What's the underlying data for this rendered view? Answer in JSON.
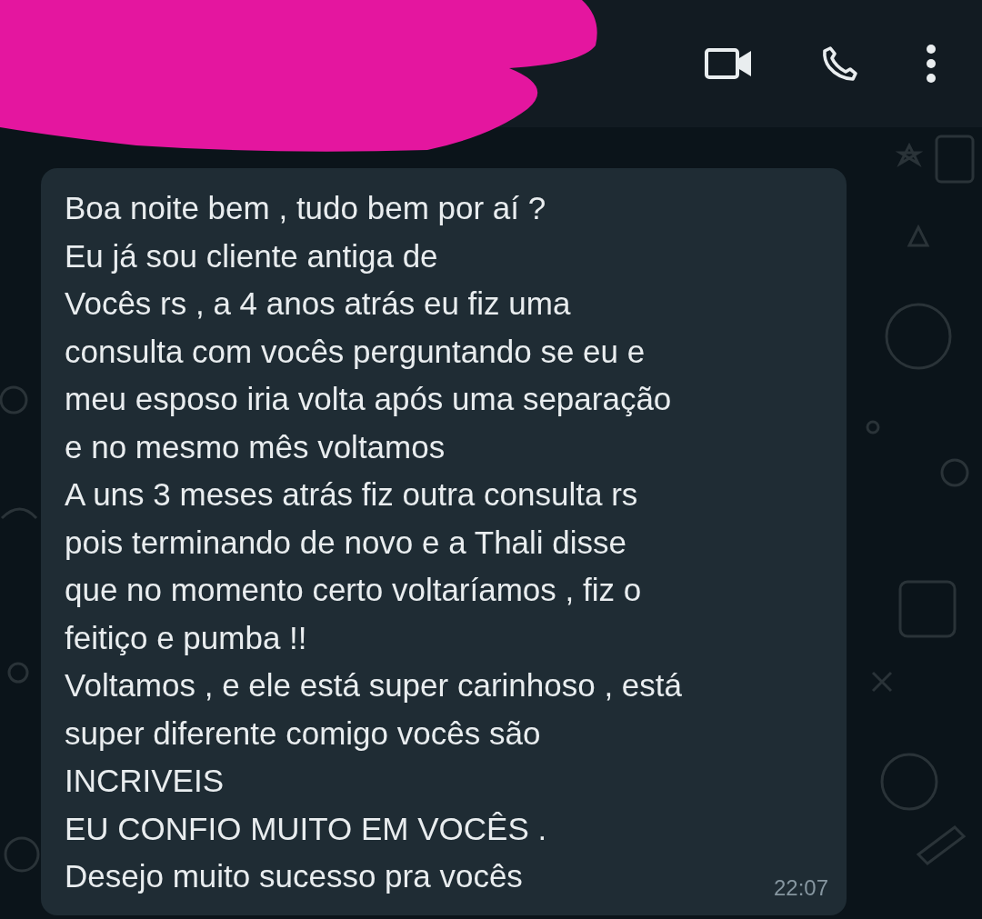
{
  "message": {
    "text": "Boa noite bem , tudo bem por aí ?\nEu já sou cliente antiga de\nVocês rs , a 4 anos atrás eu fiz uma\nconsulta com vocês perguntando se eu e\nmeu esposo iria volta após uma separação\ne no mesmo mês voltamos\nA uns 3 meses atrás fiz outra consulta rs\npois terminando de novo e a Thali disse\nque no momento certo voltaríamos , fiz o\nfeitiço e pumba !!\nVoltamos , e ele está super carinhoso , está\nsuper diferente comigo vocês são\nINCRIVEIS\nEU CONFIO MUITO EM VOCÊS .\nDesejo muito sucesso pra vocês",
    "time": "22:07"
  }
}
